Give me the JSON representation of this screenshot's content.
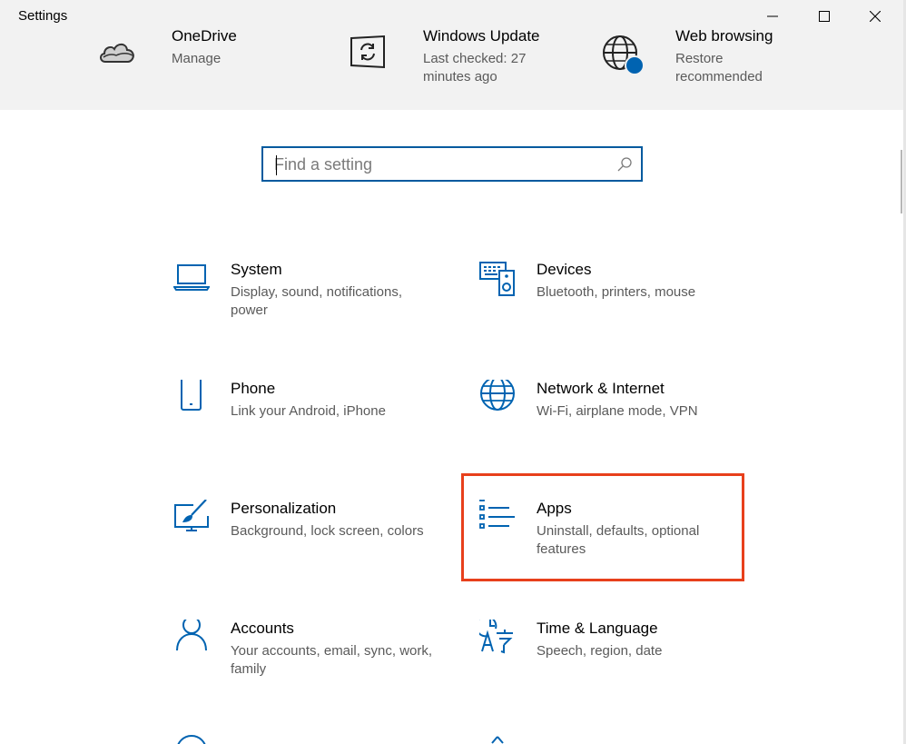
{
  "window": {
    "title": "Settings",
    "controls": {
      "minimize": "minimize",
      "maximize": "maximize",
      "close": "close"
    }
  },
  "quick_actions": [
    {
      "title": "OneDrive",
      "subtitle": "Manage",
      "icon": "cloud-icon"
    },
    {
      "title": "Windows Update",
      "subtitle": "Last checked: 27 minutes ago",
      "icon": "windows-update-icon"
    },
    {
      "title": "Web browsing",
      "subtitle": "Restore recommended",
      "icon": "globe-alert-icon"
    }
  ],
  "search": {
    "placeholder": "Find a setting",
    "value": ""
  },
  "categories": [
    {
      "title": "System",
      "subtitle": "Display, sound, notifications, power",
      "icon": "laptop-icon"
    },
    {
      "title": "Devices",
      "subtitle": "Bluetooth, printers, mouse",
      "icon": "keyboard-speaker-icon"
    },
    {
      "title": "Phone",
      "subtitle": "Link your Android, iPhone",
      "icon": "phone-icon"
    },
    {
      "title": "Network & Internet",
      "subtitle": "Wi-Fi, airplane mode, VPN",
      "icon": "globe-icon"
    },
    {
      "title": "Personalization",
      "subtitle": "Background, lock screen, colors",
      "icon": "paint-brush-icon"
    },
    {
      "title": "Apps",
      "subtitle": "Uninstall, defaults, optional features",
      "icon": "apps-list-icon",
      "highlighted": true
    },
    {
      "title": "Accounts",
      "subtitle": "Your accounts, email, sync, work, family",
      "icon": "person-icon"
    },
    {
      "title": "Time & Language",
      "subtitle": "Speech, region, date",
      "icon": "time-language-icon"
    }
  ],
  "colors": {
    "accent": "#0063b1",
    "highlight": "#e8401c",
    "header_bg": "#f2f2f2",
    "secondary_text": "#5a5a5a"
  }
}
